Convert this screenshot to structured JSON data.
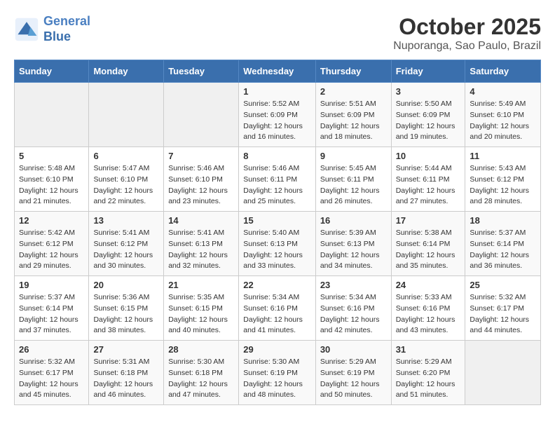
{
  "header": {
    "logo_line1": "General",
    "logo_line2": "Blue",
    "month": "October 2025",
    "location": "Nuporanga, Sao Paulo, Brazil"
  },
  "days_of_week": [
    "Sunday",
    "Monday",
    "Tuesday",
    "Wednesday",
    "Thursday",
    "Friday",
    "Saturday"
  ],
  "weeks": [
    [
      {
        "day": "",
        "info": ""
      },
      {
        "day": "",
        "info": ""
      },
      {
        "day": "",
        "info": ""
      },
      {
        "day": "1",
        "info": "Sunrise: 5:52 AM\nSunset: 6:09 PM\nDaylight: 12 hours\nand 16 minutes."
      },
      {
        "day": "2",
        "info": "Sunrise: 5:51 AM\nSunset: 6:09 PM\nDaylight: 12 hours\nand 18 minutes."
      },
      {
        "day": "3",
        "info": "Sunrise: 5:50 AM\nSunset: 6:09 PM\nDaylight: 12 hours\nand 19 minutes."
      },
      {
        "day": "4",
        "info": "Sunrise: 5:49 AM\nSunset: 6:10 PM\nDaylight: 12 hours\nand 20 minutes."
      }
    ],
    [
      {
        "day": "5",
        "info": "Sunrise: 5:48 AM\nSunset: 6:10 PM\nDaylight: 12 hours\nand 21 minutes."
      },
      {
        "day": "6",
        "info": "Sunrise: 5:47 AM\nSunset: 6:10 PM\nDaylight: 12 hours\nand 22 minutes."
      },
      {
        "day": "7",
        "info": "Sunrise: 5:46 AM\nSunset: 6:10 PM\nDaylight: 12 hours\nand 23 minutes."
      },
      {
        "day": "8",
        "info": "Sunrise: 5:46 AM\nSunset: 6:11 PM\nDaylight: 12 hours\nand 25 minutes."
      },
      {
        "day": "9",
        "info": "Sunrise: 5:45 AM\nSunset: 6:11 PM\nDaylight: 12 hours\nand 26 minutes."
      },
      {
        "day": "10",
        "info": "Sunrise: 5:44 AM\nSunset: 6:11 PM\nDaylight: 12 hours\nand 27 minutes."
      },
      {
        "day": "11",
        "info": "Sunrise: 5:43 AM\nSunset: 6:12 PM\nDaylight: 12 hours\nand 28 minutes."
      }
    ],
    [
      {
        "day": "12",
        "info": "Sunrise: 5:42 AM\nSunset: 6:12 PM\nDaylight: 12 hours\nand 29 minutes."
      },
      {
        "day": "13",
        "info": "Sunrise: 5:41 AM\nSunset: 6:12 PM\nDaylight: 12 hours\nand 30 minutes."
      },
      {
        "day": "14",
        "info": "Sunrise: 5:41 AM\nSunset: 6:13 PM\nDaylight: 12 hours\nand 32 minutes."
      },
      {
        "day": "15",
        "info": "Sunrise: 5:40 AM\nSunset: 6:13 PM\nDaylight: 12 hours\nand 33 minutes."
      },
      {
        "day": "16",
        "info": "Sunrise: 5:39 AM\nSunset: 6:13 PM\nDaylight: 12 hours\nand 34 minutes."
      },
      {
        "day": "17",
        "info": "Sunrise: 5:38 AM\nSunset: 6:14 PM\nDaylight: 12 hours\nand 35 minutes."
      },
      {
        "day": "18",
        "info": "Sunrise: 5:37 AM\nSunset: 6:14 PM\nDaylight: 12 hours\nand 36 minutes."
      }
    ],
    [
      {
        "day": "19",
        "info": "Sunrise: 5:37 AM\nSunset: 6:14 PM\nDaylight: 12 hours\nand 37 minutes."
      },
      {
        "day": "20",
        "info": "Sunrise: 5:36 AM\nSunset: 6:15 PM\nDaylight: 12 hours\nand 38 minutes."
      },
      {
        "day": "21",
        "info": "Sunrise: 5:35 AM\nSunset: 6:15 PM\nDaylight: 12 hours\nand 40 minutes."
      },
      {
        "day": "22",
        "info": "Sunrise: 5:34 AM\nSunset: 6:16 PM\nDaylight: 12 hours\nand 41 minutes."
      },
      {
        "day": "23",
        "info": "Sunrise: 5:34 AM\nSunset: 6:16 PM\nDaylight: 12 hours\nand 42 minutes."
      },
      {
        "day": "24",
        "info": "Sunrise: 5:33 AM\nSunset: 6:16 PM\nDaylight: 12 hours\nand 43 minutes."
      },
      {
        "day": "25",
        "info": "Sunrise: 5:32 AM\nSunset: 6:17 PM\nDaylight: 12 hours\nand 44 minutes."
      }
    ],
    [
      {
        "day": "26",
        "info": "Sunrise: 5:32 AM\nSunset: 6:17 PM\nDaylight: 12 hours\nand 45 minutes."
      },
      {
        "day": "27",
        "info": "Sunrise: 5:31 AM\nSunset: 6:18 PM\nDaylight: 12 hours\nand 46 minutes."
      },
      {
        "day": "28",
        "info": "Sunrise: 5:30 AM\nSunset: 6:18 PM\nDaylight: 12 hours\nand 47 minutes."
      },
      {
        "day": "29",
        "info": "Sunrise: 5:30 AM\nSunset: 6:19 PM\nDaylight: 12 hours\nand 48 minutes."
      },
      {
        "day": "30",
        "info": "Sunrise: 5:29 AM\nSunset: 6:19 PM\nDaylight: 12 hours\nand 50 minutes."
      },
      {
        "day": "31",
        "info": "Sunrise: 5:29 AM\nSunset: 6:20 PM\nDaylight: 12 hours\nand 51 minutes."
      },
      {
        "day": "",
        "info": ""
      }
    ]
  ]
}
